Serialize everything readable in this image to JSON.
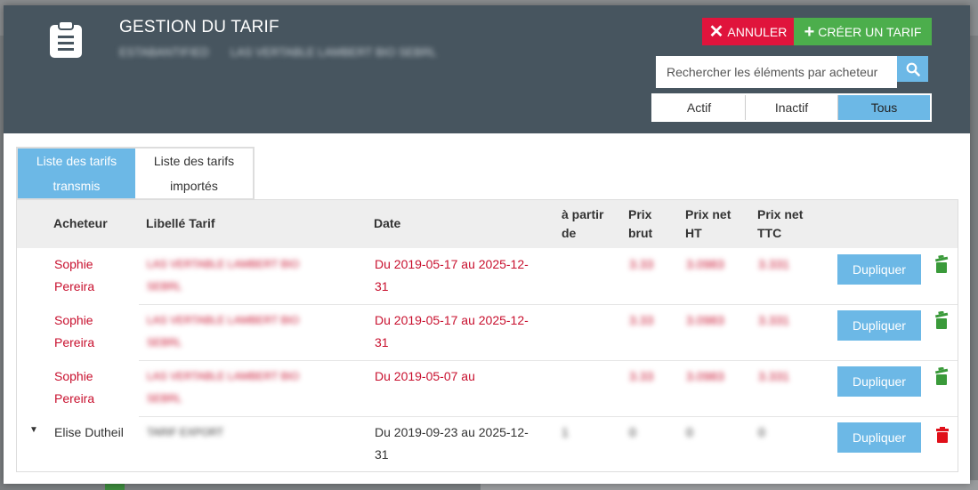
{
  "header": {
    "title": "GESTION DU TARIF",
    "subtitle_left": "ESTABANTIFIED",
    "subtitle_right": "LAS VERTABLE LAMBERT BIO SEBRL"
  },
  "actions": {
    "cancel_label": "ANNULER",
    "create_label": "CRÉER UN TARIF"
  },
  "search": {
    "placeholder": "Rechercher les éléments par acheteur",
    "value": ""
  },
  "filter": {
    "options": [
      "Actif",
      "Inactif",
      "Tous"
    ],
    "selected": "Tous"
  },
  "tabs": [
    {
      "line1": "Liste des tarifs",
      "line2": "transmis",
      "active": true
    },
    {
      "line1": "Liste des tarifs",
      "line2": "importés",
      "active": false
    }
  ],
  "table": {
    "headers": {
      "acheteur": "Acheteur",
      "libelle": "Libellé Tarif",
      "date": "Date",
      "apartir1": "à partir",
      "apartir2": "de",
      "prixbrut1": "Prix",
      "prixbrut2": "brut",
      "prixht1": "Prix net",
      "prixht2": "HT",
      "prixttc1": "Prix net",
      "prixttc2": "TTC"
    },
    "rows": [
      {
        "buyer1": "Sophie",
        "buyer2": "Pereira",
        "label1": "LAS VERTABLE LAMBERT BIO",
        "label2": "SEBRL",
        "date1": "Du 2019-05-17 au 2025-12-",
        "date2": "31",
        "apartir": "",
        "brut": "3.33",
        "ht": "3.0983",
        "ttc": "3.331",
        "action": "Dupliquer",
        "status": "active"
      },
      {
        "buyer1": "Sophie",
        "buyer2": "Pereira",
        "label1": "LAS VERTABLE LAMBERT BIO",
        "label2": "SEBRL",
        "date1": "Du 2019-05-17 au 2025-12-",
        "date2": "31",
        "apartir": "",
        "brut": "3.33",
        "ht": "3.0983",
        "ttc": "3.331",
        "action": "Dupliquer",
        "status": "active"
      },
      {
        "buyer1": "Sophie",
        "buyer2": "Pereira",
        "label1": "LAS VERTABLE LAMBERT BIO",
        "label2": "SEBRL",
        "date1": "Du 2019-05-07 au",
        "date2": "",
        "apartir": "",
        "brut": "3.33",
        "ht": "3.0983",
        "ttc": "3.331",
        "action": "Dupliquer",
        "status": "active"
      },
      {
        "buyer1": "Elise Dutheil",
        "buyer2": "",
        "label1": "TARIF EXPORT",
        "label2": "",
        "date1": "Du 2019-09-23 au 2025-12-",
        "date2": "31",
        "apartir": "1",
        "brut": "0",
        "ht": "0",
        "ttc": "0",
        "action": "Dupliquer",
        "status": "inactive"
      }
    ]
  },
  "colors": {
    "header_bg": "#47555f",
    "cancel": "#e0143c",
    "create": "#4cae4c",
    "accent": "#6cb8e6",
    "red_text": "#c8102e",
    "trash_green": "#3a9a3a",
    "trash_red": "#e0101a"
  }
}
